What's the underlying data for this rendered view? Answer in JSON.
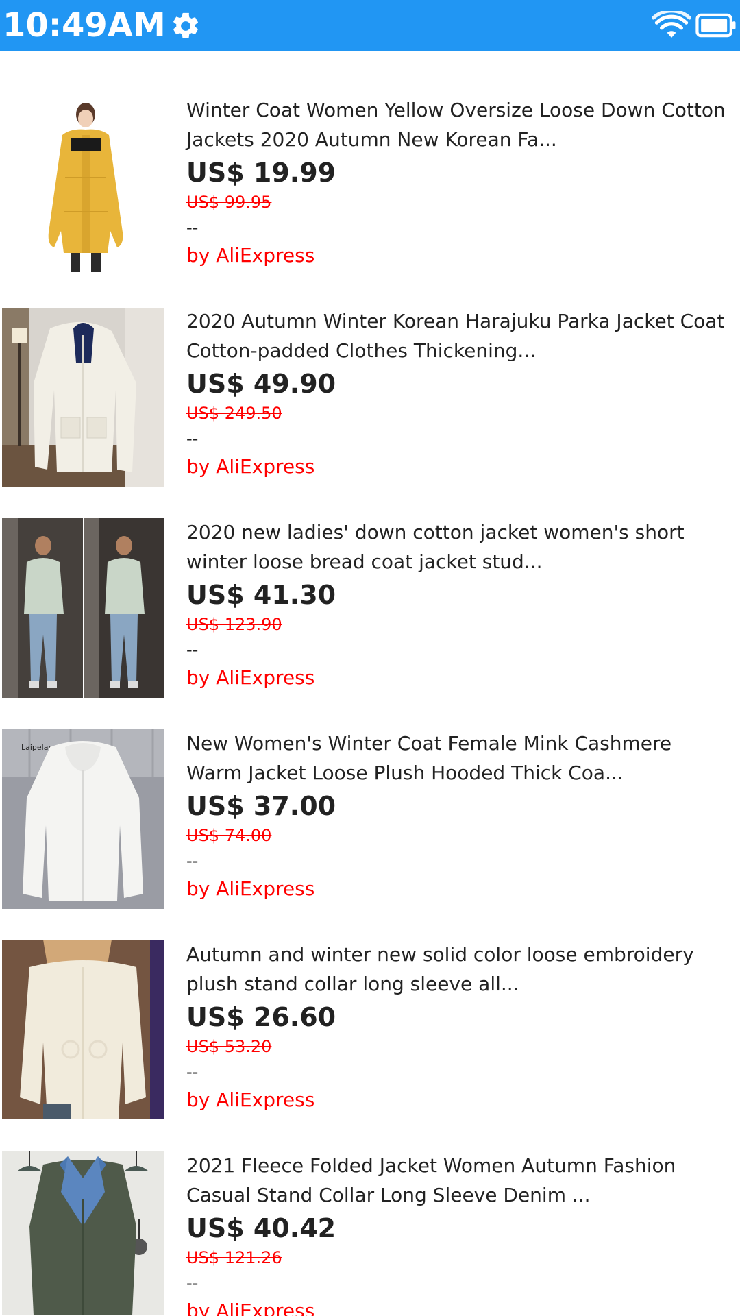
{
  "status_bar": {
    "time": "10:49AM",
    "settings_icon": "gear-icon",
    "wifi_icon": "wifi-icon",
    "battery_icon": "battery-icon",
    "color": "#2196F3"
  },
  "products": [
    {
      "title": "Winter Coat Women Yellow Oversize Loose Down Cotton Jackets 2020 Autumn New Korean Fa...",
      "price": "US$ 19.99",
      "old_price": "US$ 99.95",
      "rating": "--",
      "seller": "by AliExpress"
    },
    {
      "title": "2020 Autumn Winter Korean Harajuku Parka Jacket Coat Cotton-padded Clothes Thickening...",
      "price": "US$ 49.90",
      "old_price": "US$ 249.50",
      "rating": "--",
      "seller": "by AliExpress"
    },
    {
      "title": "2020 new ladies' down cotton jacket women's short winter loose bread coat jacket stud...",
      "price": "US$ 41.30",
      "old_price": "US$ 123.90",
      "rating": "--",
      "seller": "by AliExpress"
    },
    {
      "title": "New Women's Winter Coat Female Mink Cashmere Warm Jacket Loose Plush Hooded Thick Coa...",
      "price": "US$ 37.00",
      "old_price": "US$ 74.00",
      "rating": "--",
      "seller": "by AliExpress"
    },
    {
      "title": "Autumn and winter new solid color loose embroidery plush stand collar long sleeve all...",
      "price": "US$ 26.60",
      "old_price": "US$ 53.20",
      "rating": "--",
      "seller": "by AliExpress"
    },
    {
      "title": "2021 Fleece Folded Jacket Women Autumn Fashion Casual Stand Collar Long Sleeve Denim ...",
      "price": "US$ 40.42",
      "old_price": "US$ 121.26",
      "rating": "--",
      "seller": "by AliExpress"
    }
  ],
  "image_labels": {
    "brand_tag": "Laipelar"
  }
}
